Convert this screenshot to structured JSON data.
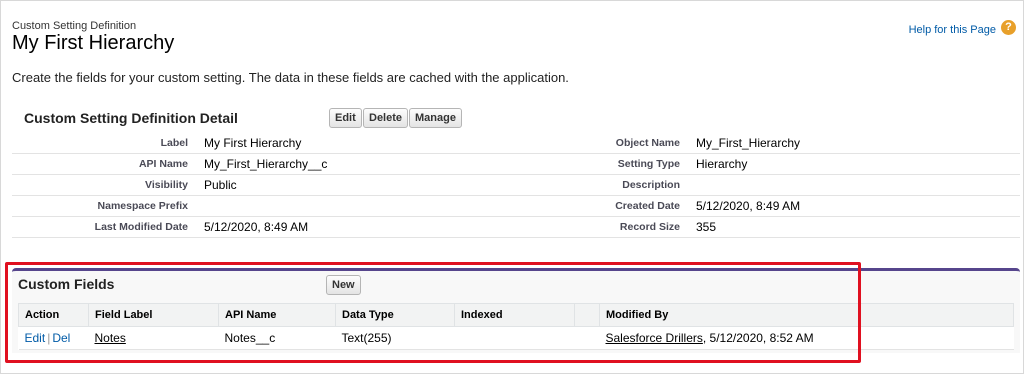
{
  "header": {
    "subtitle": "Custom Setting Definition",
    "title": "My First Hierarchy",
    "help_link": "Help for this Page",
    "help_icon": "?"
  },
  "intro_text": "Create the fields for your custom setting. The data in these fields are cached with the application.",
  "detail": {
    "section_title": "Custom Setting Definition Detail",
    "buttons": [
      "Edit",
      "Delete",
      "Manage"
    ],
    "rows": [
      {
        "label1": "Label",
        "value1": "My First Hierarchy",
        "label2": "Object Name",
        "value2": "My_First_Hierarchy"
      },
      {
        "label1": "API Name",
        "value1": "My_First_Hierarchy__c",
        "label2": "Setting Type",
        "value2": "Hierarchy"
      },
      {
        "label1": "Visibility",
        "value1": "Public",
        "label2": "Description",
        "value2": ""
      },
      {
        "label1": "Namespace Prefix",
        "value1": "",
        "label2": "Created Date",
        "value2": "5/12/2020, 8:49 AM"
      },
      {
        "label1": "Last Modified Date",
        "value1": "5/12/2020, 8:49 AM",
        "label2": "Record Size",
        "value2": "355"
      }
    ]
  },
  "custom_fields": {
    "section_title": "Custom Fields",
    "new_button": "New",
    "columns": [
      "Action",
      "Field Label",
      "API Name",
      "Data Type",
      "Indexed",
      "",
      "Modified By"
    ],
    "rows": [
      {
        "edit": "Edit",
        "separator": "|",
        "del": "Del",
        "field_label": "Notes",
        "api_name": "Notes__c",
        "data_type": "Text(255)",
        "indexed": "",
        "modified_by_user": "Salesforce Drillers",
        "modified_by_date": ", 5/12/2020, 8:52 AM"
      }
    ]
  },
  "colors": {
    "link": "#015ba7",
    "highlight": "#e01020",
    "section_accent": "#56458c"
  }
}
